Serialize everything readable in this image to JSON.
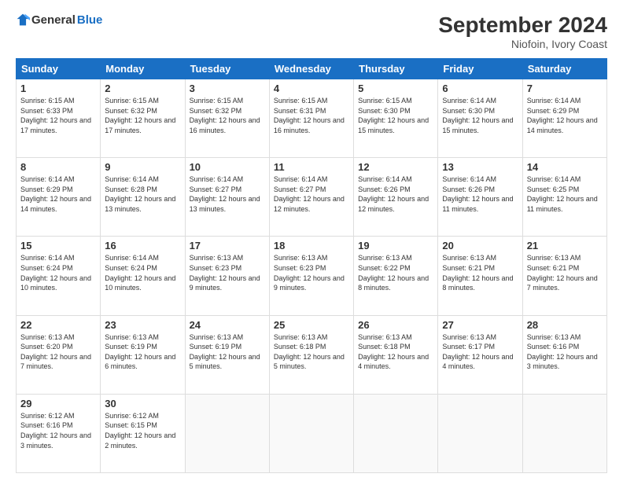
{
  "header": {
    "logo_general": "General",
    "logo_blue": "Blue",
    "month_title": "September 2024",
    "location": "Niofoin, Ivory Coast"
  },
  "columns": [
    "Sunday",
    "Monday",
    "Tuesday",
    "Wednesday",
    "Thursday",
    "Friday",
    "Saturday"
  ],
  "weeks": [
    [
      {
        "day": "1",
        "sunrise": "6:15 AM",
        "sunset": "6:33 PM",
        "daylight": "12 hours and 17 minutes."
      },
      {
        "day": "2",
        "sunrise": "6:15 AM",
        "sunset": "6:32 PM",
        "daylight": "12 hours and 17 minutes."
      },
      {
        "day": "3",
        "sunrise": "6:15 AM",
        "sunset": "6:32 PM",
        "daylight": "12 hours and 16 minutes."
      },
      {
        "day": "4",
        "sunrise": "6:15 AM",
        "sunset": "6:31 PM",
        "daylight": "12 hours and 16 minutes."
      },
      {
        "day": "5",
        "sunrise": "6:15 AM",
        "sunset": "6:30 PM",
        "daylight": "12 hours and 15 minutes."
      },
      {
        "day": "6",
        "sunrise": "6:14 AM",
        "sunset": "6:30 PM",
        "daylight": "12 hours and 15 minutes."
      },
      {
        "day": "7",
        "sunrise": "6:14 AM",
        "sunset": "6:29 PM",
        "daylight": "12 hours and 14 minutes."
      }
    ],
    [
      {
        "day": "8",
        "sunrise": "6:14 AM",
        "sunset": "6:29 PM",
        "daylight": "12 hours and 14 minutes."
      },
      {
        "day": "9",
        "sunrise": "6:14 AM",
        "sunset": "6:28 PM",
        "daylight": "12 hours and 13 minutes."
      },
      {
        "day": "10",
        "sunrise": "6:14 AM",
        "sunset": "6:27 PM",
        "daylight": "12 hours and 13 minutes."
      },
      {
        "day": "11",
        "sunrise": "6:14 AM",
        "sunset": "6:27 PM",
        "daylight": "12 hours and 12 minutes."
      },
      {
        "day": "12",
        "sunrise": "6:14 AM",
        "sunset": "6:26 PM",
        "daylight": "12 hours and 12 minutes."
      },
      {
        "day": "13",
        "sunrise": "6:14 AM",
        "sunset": "6:26 PM",
        "daylight": "12 hours and 11 minutes."
      },
      {
        "day": "14",
        "sunrise": "6:14 AM",
        "sunset": "6:25 PM",
        "daylight": "12 hours and 11 minutes."
      }
    ],
    [
      {
        "day": "15",
        "sunrise": "6:14 AM",
        "sunset": "6:24 PM",
        "daylight": "12 hours and 10 minutes."
      },
      {
        "day": "16",
        "sunrise": "6:14 AM",
        "sunset": "6:24 PM",
        "daylight": "12 hours and 10 minutes."
      },
      {
        "day": "17",
        "sunrise": "6:13 AM",
        "sunset": "6:23 PM",
        "daylight": "12 hours and 9 minutes."
      },
      {
        "day": "18",
        "sunrise": "6:13 AM",
        "sunset": "6:23 PM",
        "daylight": "12 hours and 9 minutes."
      },
      {
        "day": "19",
        "sunrise": "6:13 AM",
        "sunset": "6:22 PM",
        "daylight": "12 hours and 8 minutes."
      },
      {
        "day": "20",
        "sunrise": "6:13 AM",
        "sunset": "6:21 PM",
        "daylight": "12 hours and 8 minutes."
      },
      {
        "day": "21",
        "sunrise": "6:13 AM",
        "sunset": "6:21 PM",
        "daylight": "12 hours and 7 minutes."
      }
    ],
    [
      {
        "day": "22",
        "sunrise": "6:13 AM",
        "sunset": "6:20 PM",
        "daylight": "12 hours and 7 minutes."
      },
      {
        "day": "23",
        "sunrise": "6:13 AM",
        "sunset": "6:19 PM",
        "daylight": "12 hours and 6 minutes."
      },
      {
        "day": "24",
        "sunrise": "6:13 AM",
        "sunset": "6:19 PM",
        "daylight": "12 hours and 5 minutes."
      },
      {
        "day": "25",
        "sunrise": "6:13 AM",
        "sunset": "6:18 PM",
        "daylight": "12 hours and 5 minutes."
      },
      {
        "day": "26",
        "sunrise": "6:13 AM",
        "sunset": "6:18 PM",
        "daylight": "12 hours and 4 minutes."
      },
      {
        "day": "27",
        "sunrise": "6:13 AM",
        "sunset": "6:17 PM",
        "daylight": "12 hours and 4 minutes."
      },
      {
        "day": "28",
        "sunrise": "6:13 AM",
        "sunset": "6:16 PM",
        "daylight": "12 hours and 3 minutes."
      }
    ],
    [
      {
        "day": "29",
        "sunrise": "6:12 AM",
        "sunset": "6:16 PM",
        "daylight": "12 hours and 3 minutes."
      },
      {
        "day": "30",
        "sunrise": "6:12 AM",
        "sunset": "6:15 PM",
        "daylight": "12 hours and 2 minutes."
      },
      {
        "day": "",
        "sunrise": "",
        "sunset": "",
        "daylight": ""
      },
      {
        "day": "",
        "sunrise": "",
        "sunset": "",
        "daylight": ""
      },
      {
        "day": "",
        "sunrise": "",
        "sunset": "",
        "daylight": ""
      },
      {
        "day": "",
        "sunrise": "",
        "sunset": "",
        "daylight": ""
      },
      {
        "day": "",
        "sunrise": "",
        "sunset": "",
        "daylight": ""
      }
    ]
  ]
}
